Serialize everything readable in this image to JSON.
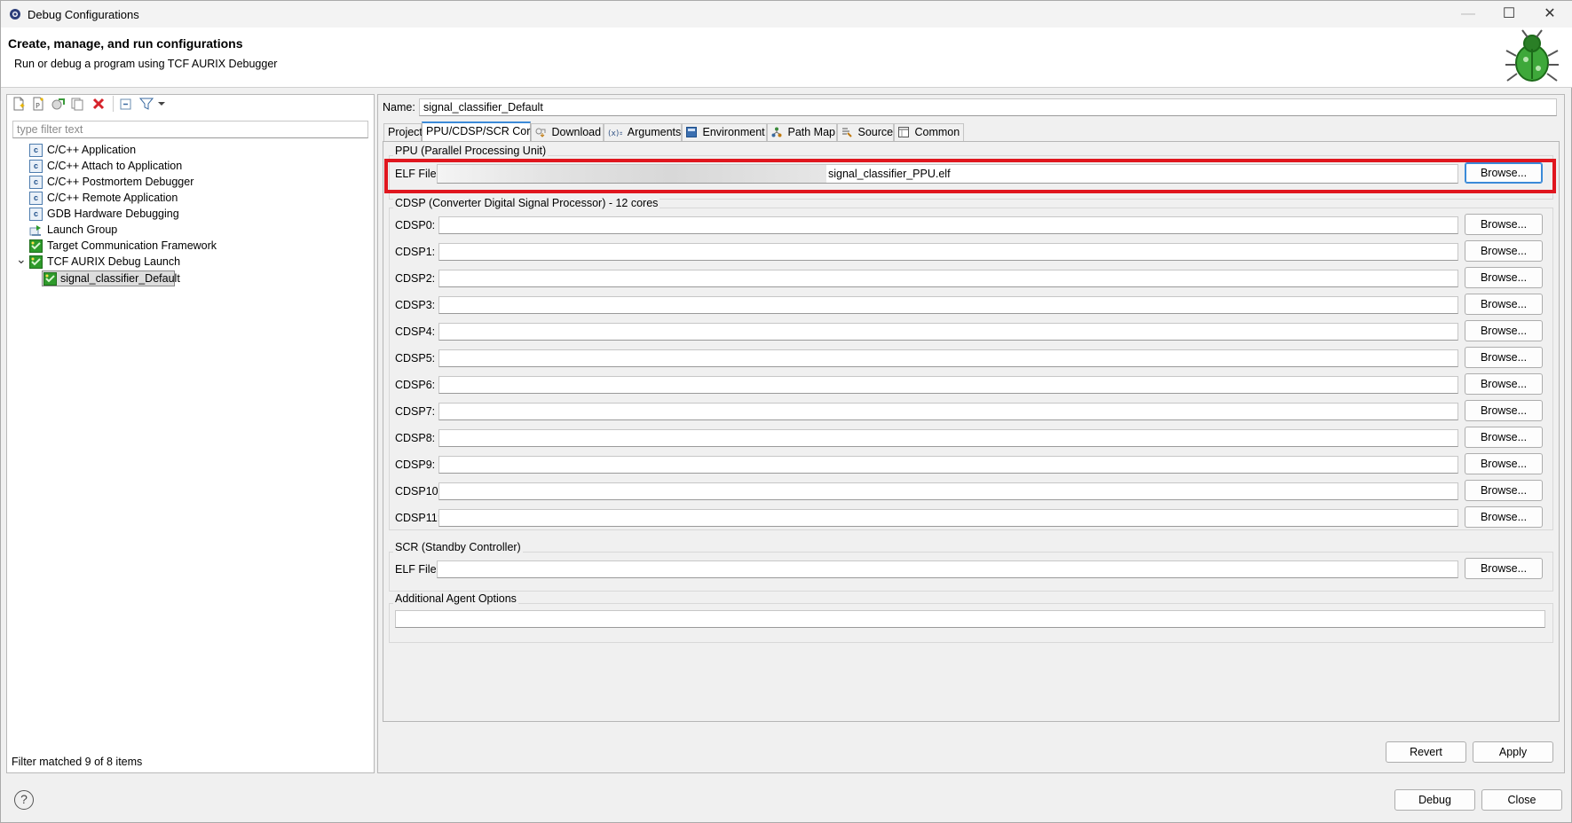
{
  "window": {
    "title": "Debug Configurations",
    "minimize_glyph": "—",
    "maximize_glyph": "☐",
    "close_glyph": "✕"
  },
  "header": {
    "title": "Create, manage, and run configurations",
    "subtitle": "Run or debug a program using TCF AURIX Debugger"
  },
  "sidebar": {
    "toolbar_icons": [
      "new-config-icon",
      "new-prototype-icon",
      "export-icon",
      "duplicate-icon",
      "delete-icon",
      "collapse-all-icon",
      "filter-icon",
      "dropdown-arrow-icon"
    ],
    "filter": {
      "placeholder": "type filter text",
      "value": ""
    },
    "tree": [
      {
        "label": "C/C++ Application",
        "icon": "c-launch-icon"
      },
      {
        "label": "C/C++ Attach to Application",
        "icon": "c-launch-icon"
      },
      {
        "label": "C/C++ Postmortem Debugger",
        "icon": "c-launch-icon"
      },
      {
        "label": "C/C++ Remote Application",
        "icon": "c-launch-icon"
      },
      {
        "label": "GDB Hardware Debugging",
        "icon": "c-launch-icon"
      },
      {
        "label": "Launch Group",
        "icon": "launch-group-icon"
      },
      {
        "label": "Target Communication Framework",
        "icon": "tcf-icon"
      },
      {
        "label": "TCF AURIX Debug Launch",
        "icon": "tcf-icon",
        "expanded": true,
        "expand_glyph": "⌄"
      },
      {
        "label": "signal_classifier_Default",
        "icon": "tcf-icon",
        "selected": true
      }
    ],
    "status": "Filter matched 9 of 8 items"
  },
  "config": {
    "name_label": "Name:",
    "name_value": "signal_classifier_Default",
    "tabs": [
      {
        "label": "Project",
        "icon": ""
      },
      {
        "label": "PPU/CDSP/SCR Cores",
        "icon": "",
        "active": true
      },
      {
        "label": "Download",
        "icon": "download-icon"
      },
      {
        "label": "Arguments",
        "icon": "arguments-icon"
      },
      {
        "label": "Environment",
        "icon": "environment-icon"
      },
      {
        "label": "Path Map",
        "icon": "path-map-icon"
      },
      {
        "label": "Source",
        "icon": "source-icon"
      },
      {
        "label": "Common",
        "icon": "common-icon"
      }
    ],
    "ppu": {
      "group_title": "PPU (Parallel Processing Unit)",
      "elf_label": "ELF File:",
      "elf_value": "signal_classifier_PPU.elf",
      "browse": "Browse..."
    },
    "cdsp": {
      "group_title": "CDSP (Converter Digital Signal Processor) - 12 cores",
      "rows": [
        {
          "label": "CDSP0:",
          "value": ""
        },
        {
          "label": "CDSP1:",
          "value": ""
        },
        {
          "label": "CDSP2:",
          "value": ""
        },
        {
          "label": "CDSP3:",
          "value": ""
        },
        {
          "label": "CDSP4:",
          "value": ""
        },
        {
          "label": "CDSP5:",
          "value": ""
        },
        {
          "label": "CDSP6:",
          "value": ""
        },
        {
          "label": "CDSP7:",
          "value": ""
        },
        {
          "label": "CDSP8:",
          "value": ""
        },
        {
          "label": "CDSP9:",
          "value": ""
        },
        {
          "label": "CDSP10:",
          "value": ""
        },
        {
          "label": "CDSP11:",
          "value": ""
        }
      ],
      "browse": "Browse..."
    },
    "scr": {
      "group_title": "SCR (Standby Controller)",
      "elf_label": "ELF File:",
      "elf_value": "",
      "browse": "Browse..."
    },
    "agent": {
      "group_title": "Additional Agent Options",
      "value": ""
    },
    "revert": "Revert",
    "apply": "Apply"
  },
  "footer": {
    "help_glyph": "?",
    "debug": "Debug",
    "close": "Close"
  },
  "colors": {
    "highlight_border": "#e0161e",
    "accent": "#3b8ad8",
    "tcf_green": "#2e9a2b"
  }
}
